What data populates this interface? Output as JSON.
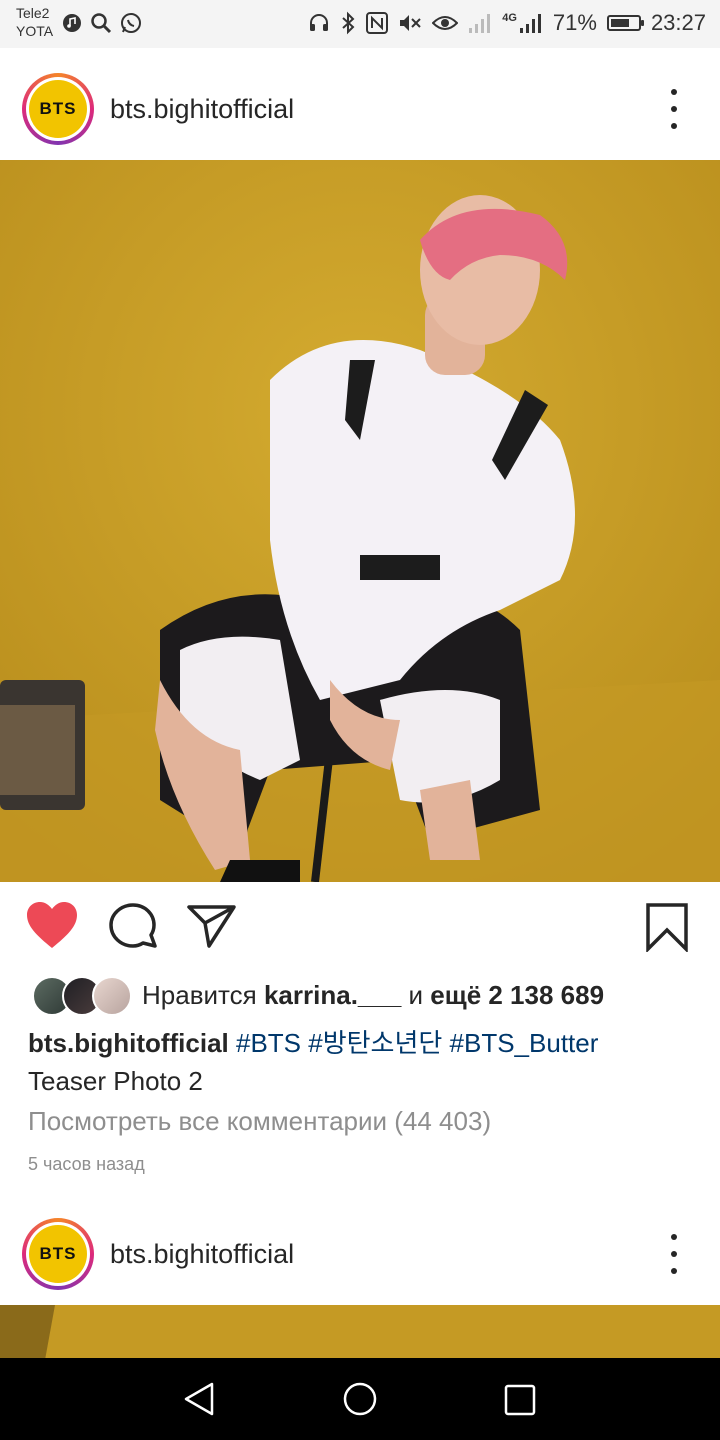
{
  "status_bar": {
    "carrier_1": "Tele2",
    "carrier_2": "YOTA",
    "battery": "71%",
    "battery_level": 0.71,
    "network": "4G",
    "time": "23:27",
    "icons": [
      "music-icon",
      "search-icon",
      "whatsapp-icon",
      "headset-icon",
      "bluetooth-icon",
      "nfc-icon",
      "mute-icon",
      "eye-icon",
      "signal-icon",
      "signal-4g-icon",
      "battery-icon"
    ]
  },
  "post": {
    "avatar_text": "BTS",
    "username": "bts.bighitofficial",
    "liked": true,
    "likes_prefix": "Нравится",
    "liked_by": "karrina.___",
    "likes_joiner": "и",
    "likes_more": "ещё 2 138 689",
    "caption_user": "bts.bighitofficial",
    "caption_tags": "#BTS #방탄소년단 #BTS_Butter",
    "caption_text": "Teaser Photo 2",
    "view_comments": "Посмотреть все комментарии (44 403)",
    "time_ago": "5 часов назад"
  },
  "next_post": {
    "avatar_text": "BTS",
    "username": "bts.bighitofficial"
  },
  "colors": {
    "like_red": "#ed4956",
    "photo_bg": "#c9a028",
    "tag_blue": "#00376b",
    "muted": "#8e8e8e"
  }
}
